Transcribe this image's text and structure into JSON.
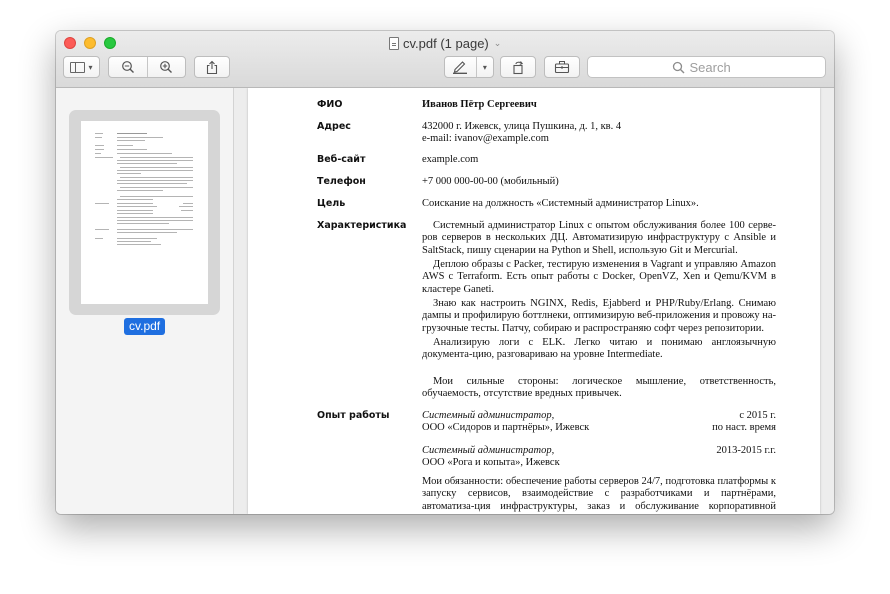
{
  "window": {
    "title": "cv.pdf (1 page)"
  },
  "search": {
    "placeholder": "Search"
  },
  "sidebar": {
    "thumbnail_label": "cv.pdf"
  },
  "doc": {
    "fio_label": "ФИО",
    "fio_value": "Иванов Пётр Сергеевич",
    "address_label": "Адрес",
    "address_line1": "432000 г. Ижевск, улица Пушкина, д. 1, кв. 4",
    "address_line2": "e-mail: ivanov@example.com",
    "website_label": "Веб-сайт",
    "website_value": "example.com",
    "phone_label": "Телефон",
    "phone_value": "+7 000 000-00-00 (мобильный)",
    "goal_label": "Цель",
    "goal_value": "Соискание на должность «Системный администратор Linux».",
    "characteristics_label": "Характеристика",
    "char_p1": "Системный администратор Linux с опытом обслуживания более 100 серве-ров серверов в нескольких ДЦ. Автоматизирую инфраструктуру с Ansible и SaltStack, пишу сценарии на Python и Shell, использую Git и Mercurial.",
    "char_p2": "Деплою образы с Packer, тестирую изменения в Vagrant и управляю Amazon AWS с Terraform. Есть опыт работы с Docker, OpenVZ, Xen и Qemu/KVM в кластере Ganeti.",
    "char_p3": "Знаю как настроить NGINX, Redis, Ejabberd и PHP/Ruby/Erlang. Снимаю дампы и профилирую боттлнеки, оптимизирую веб-приложения и провожу на-грузочные тесты. Патчу, собираю и распространяю софт через репозитории.",
    "char_p4": "Анализирую логи с ELK. Легко читаю и понимаю англоязычную документа-цию, разговариваю на уровне Intermediate.",
    "char_p5": "Мои сильные стороны: логическое мышление, ответственность, обучаемость, отсутствие вредных привычек.",
    "experience_label": "Опыт работы",
    "job1_title": "Системный администратор,",
    "job1_date": "с 2015 г.",
    "job1_company": "ООО «Сидоров и партнёры», Ижевск",
    "job1_until": "по наст. время",
    "job2_title": "Системный администратор,",
    "job2_date": "2013-2015 г.г.",
    "job2_company": "ООО «Рога и копыта», Ижевск",
    "duties": "Мои обязанности: обеспечение работы серверов 24/7, подготовка платформы к запуску сервисов, взаимодействие с разработчиками и партнёрами, автоматиза-ция инфраструктуры, заказ и обслуживание корпоративной техники."
  }
}
